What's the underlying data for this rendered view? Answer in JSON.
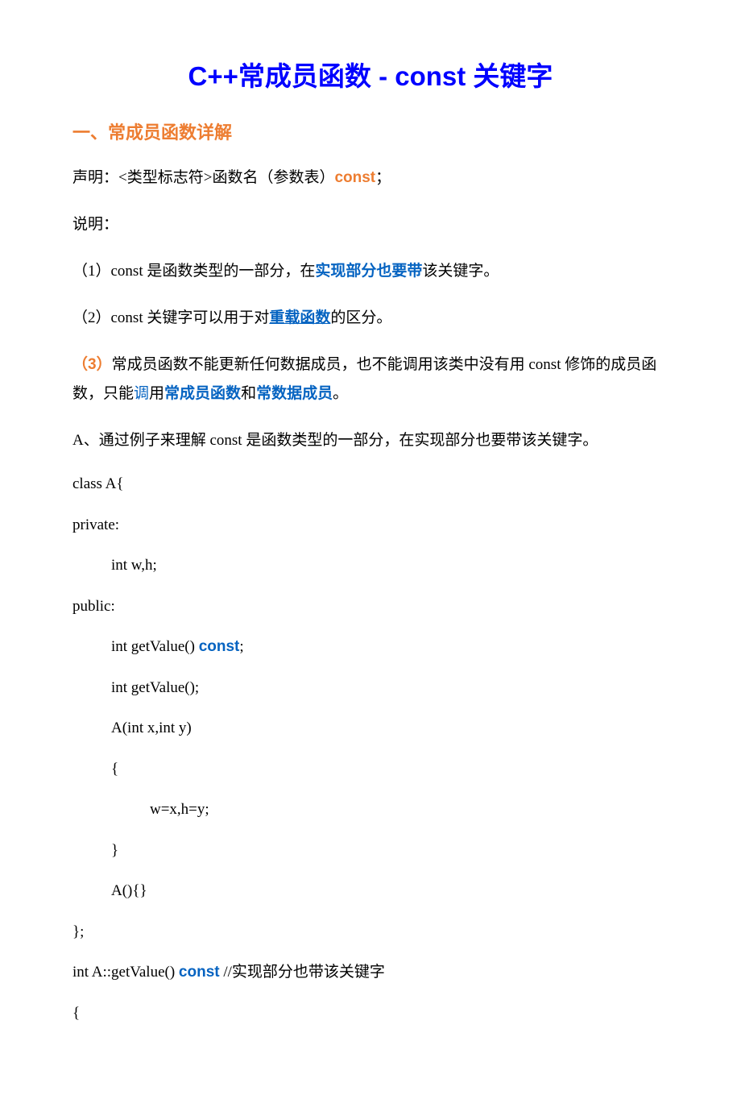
{
  "title": "C++常成员函数  - const 关键字",
  "section1_heading": "一、常成员函数详解",
  "decl_prefix": "声明：",
  "decl_body1": "<类型标志符>函数名（参数表）",
  "decl_const": "const",
  "decl_semicolon": "；",
  "notes_label": "说明：",
  "note1_pre": "（1）const 是函数类型的一部分，在",
  "note1_blue": "实现部分也要带",
  "note1_post": "该关键字。",
  "note2_pre": "（2）const 关键字可以用于对",
  "note2_blue": "重载函数",
  "note2_post": "的区分。",
  "note3_num_open": "（",
  "note3_num": "3",
  "note3_num_close": "）",
  "note3_body1": "常成员函数不能更新任何数据成员，也不能调用该类中没有用 const 修饰的成员函数，只能",
  "note3_blue1": "调",
  "note3_body2": "用",
  "note3_blue2": "常成员函数",
  "note3_body3": "和",
  "note3_blue3": "常数据成员",
  "note3_body4": "。",
  "exampleA_intro": "A、通过例子来理解 const 是函数类型的一部分，在实现部分也要带该关键字。",
  "code": {
    "l1": "class A{",
    "l2": "private:",
    "l3": "int w,h;",
    "l4": "public:",
    "l5_pre": "int getValue() ",
    "l5_const": "const",
    "l5_post": ";",
    "l6": "int getValue();",
    "l7": "A(int x,int y)",
    "l8": "{",
    "l9": "w=x,h=y;",
    "l10": "}",
    "l11": "A(){}",
    "l12": "};",
    "l13_pre": "int A::getValue() ",
    "l13_const": "const",
    "l13_comment": "       //实现部分也带该关键字",
    "l14": "{"
  }
}
